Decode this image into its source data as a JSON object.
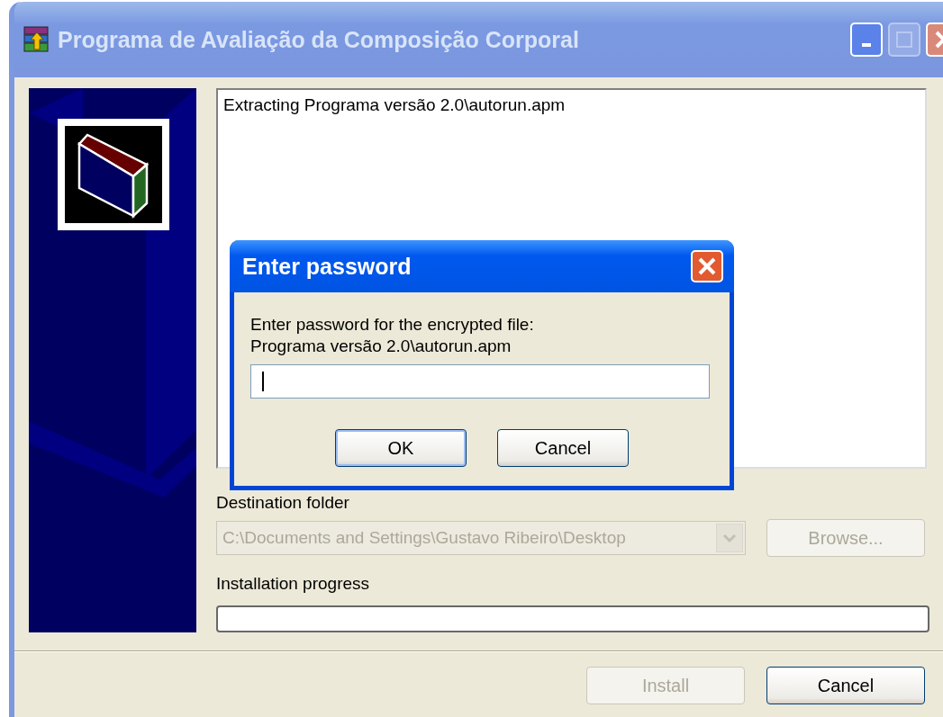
{
  "window": {
    "title": "Programa de Avaliação da Composição Corporal",
    "active": false,
    "maximize_disabled": true
  },
  "log": {
    "lines": [
      "Extracting Programa versão 2.0\\autorun.apm"
    ]
  },
  "destination": {
    "label": "Destination folder",
    "value": "C:\\Documents and Settings\\Gustavo Ribeiro\\Desktop",
    "disabled": true
  },
  "browse_button": {
    "label": "Browse...",
    "disabled": true
  },
  "progress": {
    "label": "Installation progress",
    "level": 0
  },
  "buttons": [
    {
      "label": "Install",
      "disabled": true
    },
    {
      "label": "Cancel",
      "disabled": false
    }
  ],
  "dialog": {
    "title": "Enter password",
    "message": "Enter password for the encrypted file:",
    "file": "Programa versão 2.0\\autorun.apm",
    "password": {
      "focused": true
    },
    "buttons": [
      {
        "label": "OK",
        "default": true
      },
      {
        "label": "Cancel",
        "default": false
      }
    ]
  }
}
